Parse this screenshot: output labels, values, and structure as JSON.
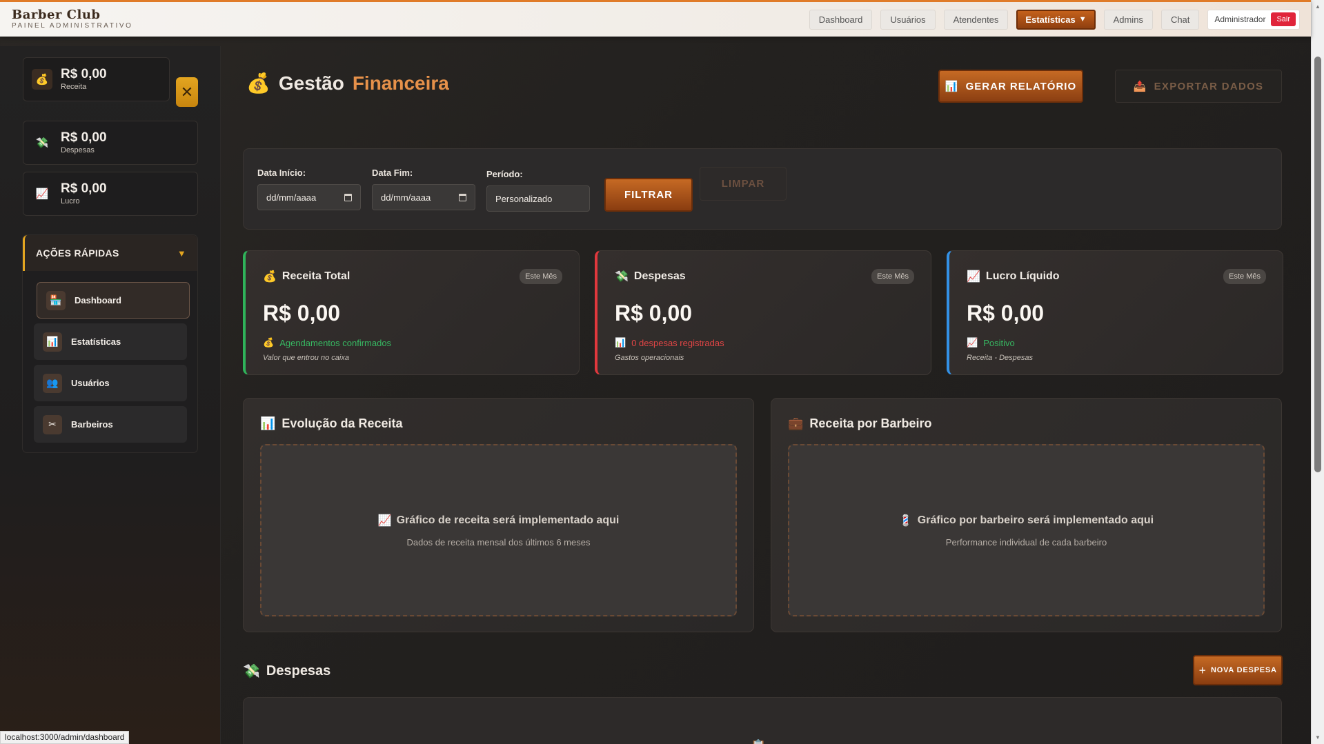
{
  "brand": {
    "title": "Barber Club",
    "subtitle": "PAINEL ADMINISTRATIVO"
  },
  "nav": {
    "items": [
      "Dashboard",
      "Usuários",
      "Atendentes",
      "Estatísticas",
      "Admins",
      "Chat"
    ],
    "active": "Estatísticas",
    "user": "Administrador",
    "logout": "Sair"
  },
  "sidebar": {
    "stats": [
      {
        "value": "R$ 0,00",
        "label": "Receita",
        "icon": "money-bag-icon"
      },
      {
        "value": "R$ 0,00",
        "label": "Despesas",
        "icon": "money-wings-icon"
      },
      {
        "value": "R$ 0,00",
        "label": "Lucro",
        "icon": "chart-up-icon"
      }
    ],
    "quick_actions": {
      "title": "AÇÕES RÁPIDAS",
      "items": [
        "Dashboard",
        "Estatísticas",
        "Usuários",
        "Barbeiros"
      ]
    }
  },
  "page": {
    "title_part1": "Gestão",
    "title_part2": "Financeira",
    "report_btn": "GERAR RELATÓRIO",
    "export_btn": "EXPORTAR DADOS"
  },
  "filter": {
    "start_label": "Data Início:",
    "start_value": "dd/mm/aaaa",
    "end_label": "Data Fim:",
    "end_value": "dd/mm/aaaa",
    "period_label": "Período:",
    "period_value": "Personalizado",
    "filter_btn": "FILTRAR",
    "clear_btn": "LIMPAR"
  },
  "kpis": [
    {
      "title": "Receita Total",
      "badge": "Este Mês",
      "value": "R$ 0,00",
      "sub": "Agendamentos confirmados",
      "note": "Valor que entrou no caixa"
    },
    {
      "title": "Despesas",
      "badge": "Este Mês",
      "value": "R$ 0,00",
      "sub": "0 despesas registradas",
      "note": "Gastos operacionais"
    },
    {
      "title": "Lucro Líquido",
      "badge": "Este Mês",
      "value": "R$ 0,00",
      "sub": "Positivo",
      "note": "Receita - Despesas"
    }
  ],
  "charts": [
    {
      "title": "Evolução da Receita",
      "msg": "Gráfico de receita será implementado aqui",
      "hint": "Dados de receita mensal dos últimos 6 meses"
    },
    {
      "title": "Receita por Barbeiro",
      "msg": "Gráfico por barbeiro será implementado aqui",
      "hint": "Performance individual de cada barbeiro"
    }
  ],
  "expenses": {
    "title": "Despesas",
    "new_btn": "NOVA DESPESA"
  },
  "status_url": "localhost:3000/admin/dashboard"
}
